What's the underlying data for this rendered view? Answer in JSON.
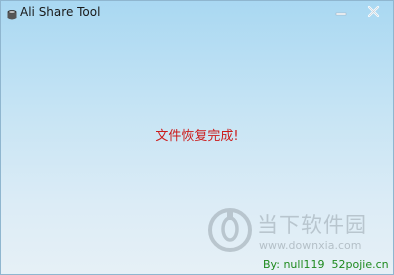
{
  "window": {
    "title": "Ali Share Tool"
  },
  "icons": {
    "app": "app-icon",
    "minimize": "minimize-icon",
    "close": "close-icon",
    "watermark_logo": "watermark-logo-icon"
  },
  "colors": {
    "message": "#cc1a1a",
    "credit": "#1e8a1e"
  },
  "main": {
    "status_message": "文件恢复完成!"
  },
  "watermark": {
    "brand": "当下软件园",
    "url": "www.downxia.com"
  },
  "footer": {
    "credit_author": "By: null119",
    "credit_site": "52pojie.cn"
  }
}
